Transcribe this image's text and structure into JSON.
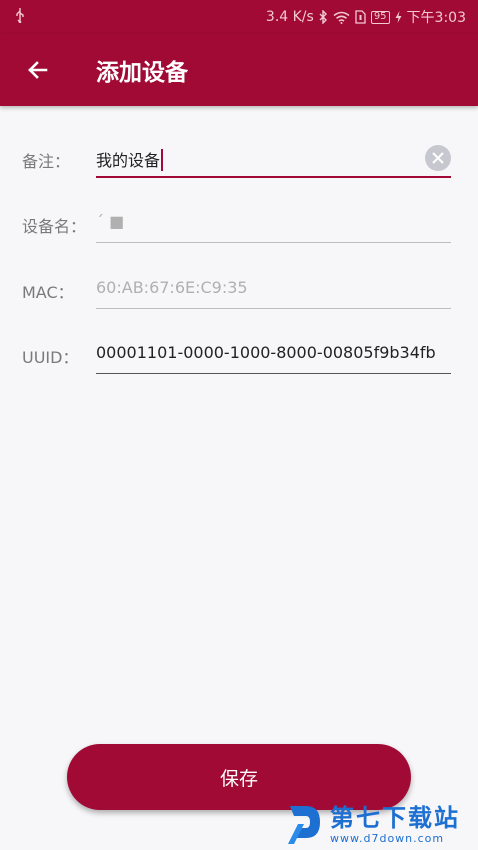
{
  "status_bar": {
    "speed": "3.4 K/s",
    "battery": "95",
    "time": "下午3:03",
    "icons": [
      "usb-icon",
      "bluetooth-icon",
      "wifi-icon",
      "sim-icon",
      "battery-icon",
      "charging-icon"
    ]
  },
  "app_bar": {
    "title": "添加设备",
    "back_icon": "arrow-left-icon"
  },
  "form": {
    "remark": {
      "label": "备注：",
      "value": "我的设备"
    },
    "device_name": {
      "label": "设备名：",
      "value": "ˊ ■"
    },
    "mac": {
      "label": "MAC：",
      "placeholder": "60:AB:67:6E:C9:35"
    },
    "uuid": {
      "label": "UUID：",
      "value": "00001101-0000-1000-8000-00805f9b34fb"
    }
  },
  "save_button": {
    "label": "保存"
  },
  "watermark": {
    "text": "第七下载站",
    "url": "www.d7down.com"
  },
  "colors": {
    "primary": "#a00a34",
    "background": "#f7f7f9",
    "watermark": "#1d6fd1"
  }
}
